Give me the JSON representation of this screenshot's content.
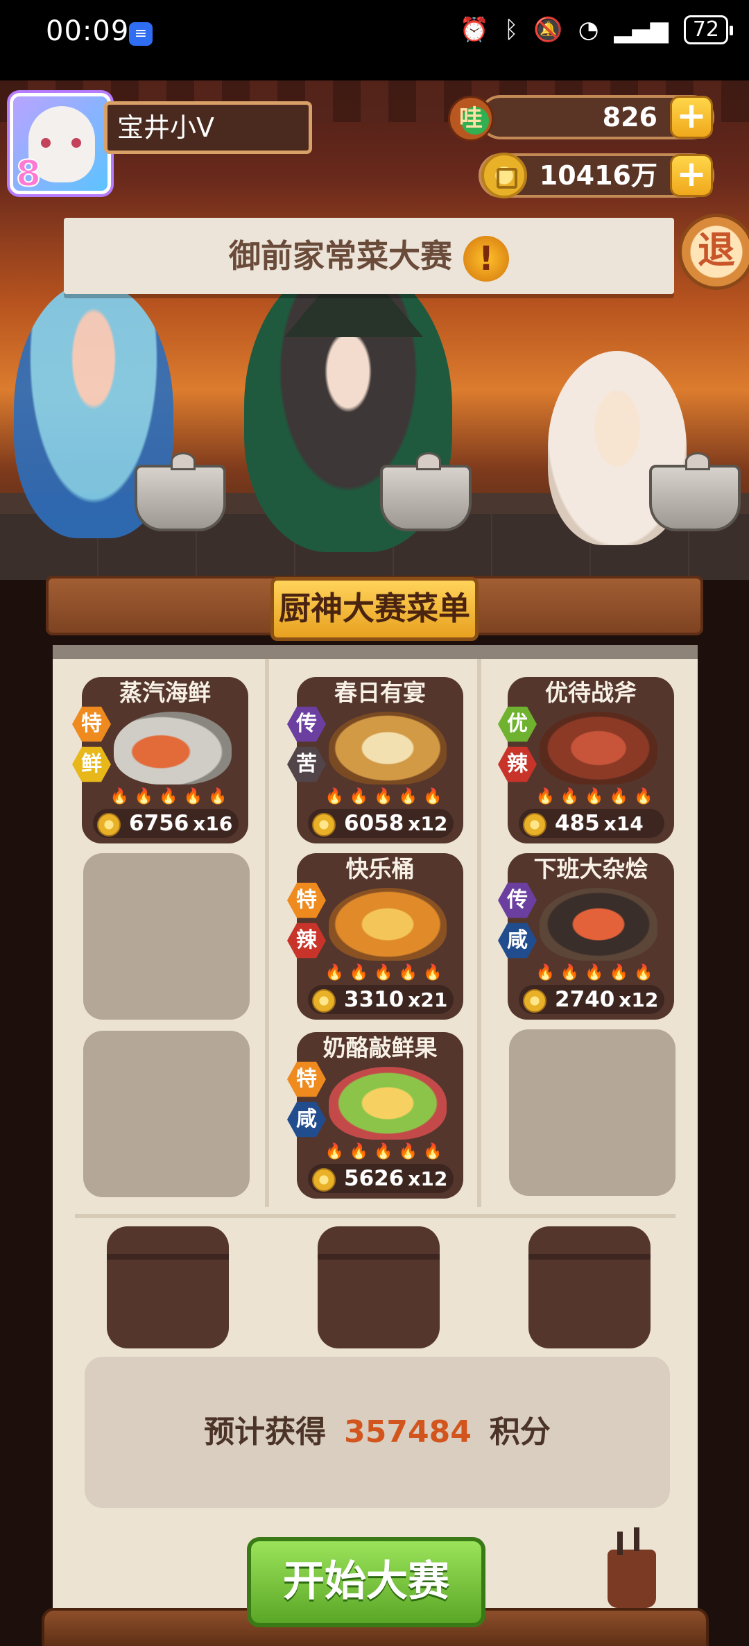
{
  "status_bar": {
    "time": "00:09",
    "app_icon": "message-app-icon",
    "icons": [
      "alarm-icon",
      "bluetooth-icon",
      "mute-icon",
      "wifi-icon",
      "signal-icon"
    ],
    "battery": "72"
  },
  "header": {
    "player_name": "宝井小V",
    "avatar_level": "8",
    "gem_label": "哇",
    "gems": "826",
    "coins": "10416万",
    "exit_label": "退"
  },
  "contest": {
    "title": "御前家常菜大赛",
    "alert_icon": "!"
  },
  "menu": {
    "title": "厨神大赛菜单",
    "dishes": [
      {
        "name": "蒸汽海鲜",
        "tags": [
          "特",
          "鲜"
        ],
        "price": "6756",
        "count": "x16"
      },
      {
        "name": "春日有宴",
        "tags": [
          "传",
          "苦"
        ],
        "price": "6058",
        "count": "x12"
      },
      {
        "name": "优待战斧",
        "tags": [
          "优",
          "辣"
        ],
        "price": "485",
        "count": "x14"
      },
      {
        "name": "快乐桶",
        "tags": [
          "特",
          "辣"
        ],
        "price": "3310",
        "count": "x21"
      },
      {
        "name": "下班大杂烩",
        "tags": [
          "传",
          "咸"
        ],
        "price": "2740",
        "count": "x12"
      },
      {
        "name": "奶酪敲鲜果",
        "tags": [
          "特",
          "咸"
        ],
        "price": "5626",
        "count": "x12"
      }
    ]
  },
  "score": {
    "prefix": "预计获得",
    "value": "357484",
    "suffix": "积分"
  },
  "actions": {
    "start_label": "开始大赛"
  },
  "colors": {
    "accent_orange": "#d2551e",
    "start_green": "#5aa626",
    "card_brown": "#54362d",
    "paper": "#ece3d3"
  }
}
